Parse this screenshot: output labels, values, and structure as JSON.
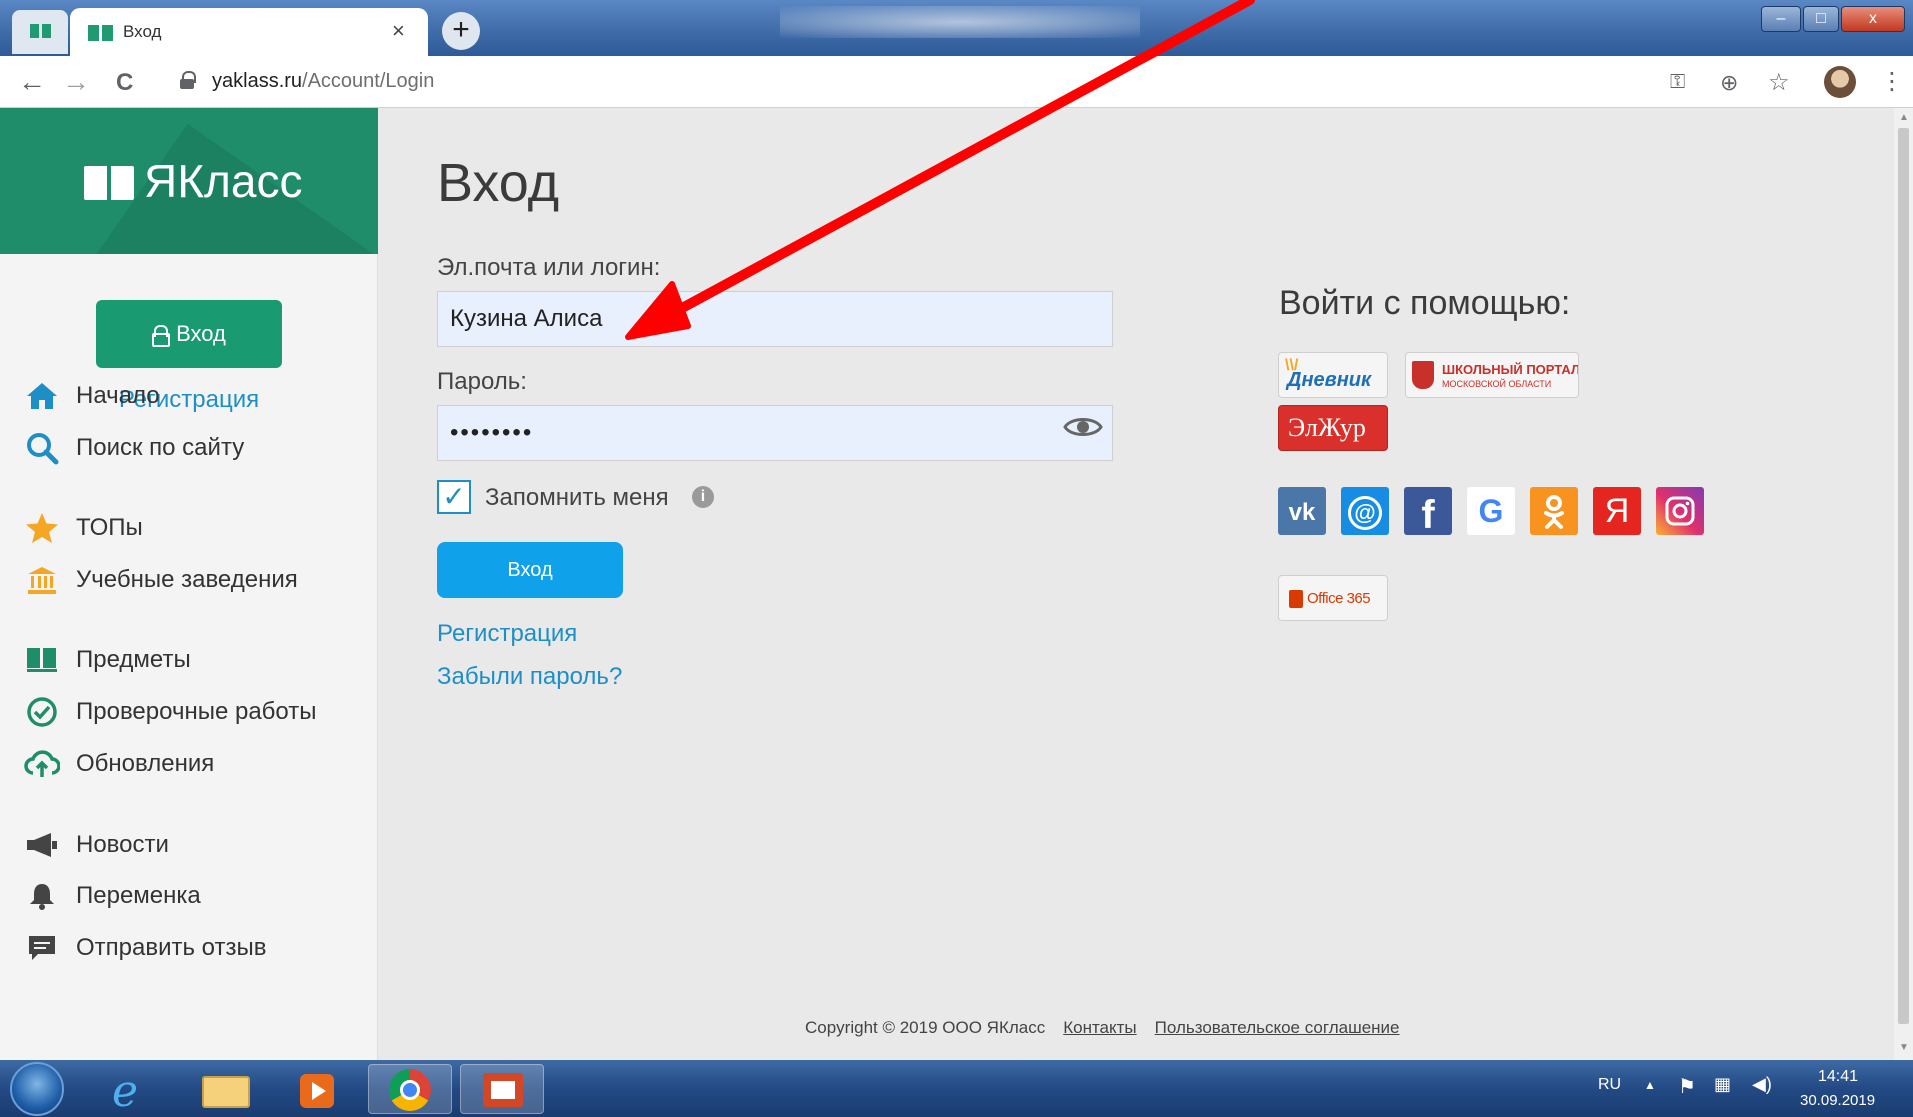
{
  "browser": {
    "tab_title": "Вход",
    "tab_close": "×",
    "new_tab": "+",
    "url_domain": "yaklass.ru",
    "url_path": "/Account/Login",
    "nav_back": "←",
    "nav_forward": "→",
    "nav_reload": "C",
    "addr_icons": [
      "key-icon",
      "add-circle-icon",
      "star-icon",
      "more-icon"
    ],
    "window_buttons": {
      "minimize": "–",
      "maximize": "□",
      "close": "x"
    }
  },
  "sidebar": {
    "logo_text": "ЯКласс",
    "login_button": "Вход",
    "register_link": "Регистрация",
    "items": [
      {
        "label": "Начало",
        "icon": "home-icon",
        "color": "#1e8fc6"
      },
      {
        "label": "Поиск по сайту",
        "icon": "search-icon",
        "color": "#1e8fc6"
      },
      {
        "label": "ТОПы",
        "icon": "star-icon",
        "color": "#f5a623"
      },
      {
        "label": "Учебные заведения",
        "icon": "institution-icon",
        "color": "#f5a623"
      },
      {
        "label": "Предметы",
        "icon": "books-icon",
        "color": "#1f8d6a"
      },
      {
        "label": "Проверочные работы",
        "icon": "check-circle-icon",
        "color": "#1f8d6a"
      },
      {
        "label": "Обновления",
        "icon": "cloud-upload-icon",
        "color": "#1f8d6a"
      },
      {
        "label": "Новости",
        "icon": "megaphone-icon",
        "color": "#444444"
      },
      {
        "label": "Переменка",
        "icon": "bell-icon",
        "color": "#444444"
      },
      {
        "label": "Отправить отзыв",
        "icon": "feedback-icon",
        "color": "#444444"
      }
    ]
  },
  "form": {
    "title": "Вход",
    "login_label": "Эл.почта или логин:",
    "login_value": "Кузина Алиса",
    "password_label": "Пароль:",
    "password_value": "••••••••",
    "remember_checked": true,
    "remember_label": "Запомнить меня",
    "info_glyph": "i",
    "submit_label": "Вход",
    "register_link": "Регистрация",
    "forgot_link": "Забыли пароль?"
  },
  "social": {
    "title": "Войти с помощью:",
    "dnevnik": "Дневник",
    "portal_line1": "ШКОЛЬНЫЙ ПОРТАЛ",
    "portal_line2": "МОСКОВСКОЙ ОБЛАСТИ",
    "elzhur": "ЭлЖур",
    "office": "Office 365",
    "networks": [
      {
        "name": "vk",
        "glyph": "vk",
        "color": "#4a76a8"
      },
      {
        "name": "mail",
        "glyph": "@",
        "color": "#168de2"
      },
      {
        "name": "facebook",
        "glyph": "f",
        "color": "#3b5998"
      },
      {
        "name": "google",
        "glyph": "G",
        "color": "#ffffff"
      },
      {
        "name": "odnoklassniki",
        "glyph": "ok",
        "color": "#f7931e"
      },
      {
        "name": "yandex",
        "glyph": "Я",
        "color": "#e52620"
      },
      {
        "name": "instagram",
        "glyph": "ig",
        "color": "#c13584"
      }
    ]
  },
  "footer": {
    "copyright": "Copyright © 2019 ООО ЯКласс",
    "contacts": "Контакты",
    "agreement": "Пользовательское соглашение"
  },
  "taskbar": {
    "lang": "RU",
    "time": "14:41",
    "date": "30.09.2019",
    "apps": [
      "start-orb",
      "ie-icon",
      "explorer-icon",
      "media-player-icon",
      "chrome-icon",
      "powerpoint-icon"
    ]
  },
  "colors": {
    "brand_green": "#1f8d6a",
    "link_blue": "#1e8fc6",
    "submit_blue": "#0fa1ea",
    "arrow_red": "#ff0000"
  }
}
